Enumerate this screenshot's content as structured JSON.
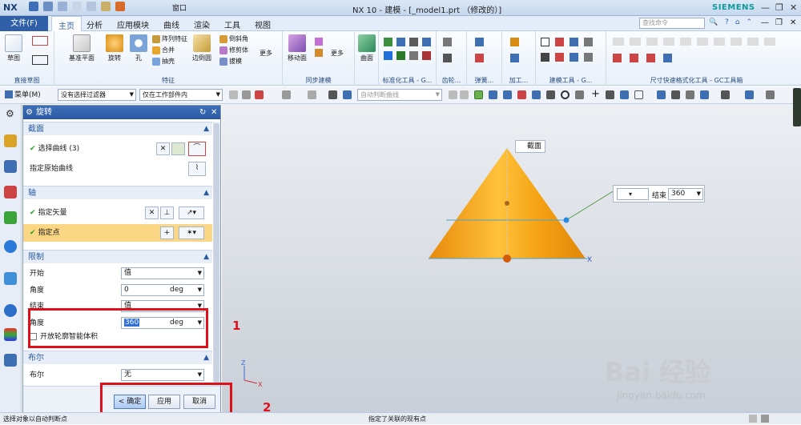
{
  "app": {
    "logo": "NX",
    "title": "NX 10 - 建模 - [_model1.prt （修改的）]",
    "brand": "SIEMENS",
    "window_menu": "窗口",
    "search_placeholder": "查找命令"
  },
  "tabs": {
    "file": "文件(F)",
    "items": [
      "主页",
      "分析",
      "应用模块",
      "曲线",
      "渲染",
      "工具",
      "视图"
    ],
    "active": "主页"
  },
  "ribbon": {
    "sketch": {
      "label": "草图",
      "group": "直接草图"
    },
    "feature": {
      "group": "特征",
      "datum": "基准平面",
      "revolve": "旋转",
      "hole": "孔",
      "pattern": "阵列特征",
      "unite": "合并",
      "shell": "抽壳",
      "edge_blend": "边倒圆",
      "chamfer": "倒斜角",
      "trim_body": "修剪体",
      "draft": "拔模",
      "more": "更多"
    },
    "sync": {
      "group": "同步建模",
      "move_face": "移动面",
      "more": "更多"
    },
    "surface": {
      "face": "曲面"
    },
    "groups_right": [
      "标准化工具 - G...",
      "齿轮...",
      "弹簧...",
      "加工...",
      "建模工具 - G...",
      "尺寸快速格式化工具 - GC工具箱"
    ]
  },
  "toolbar2": {
    "menu": "菜单(M)",
    "filter": "没有选择过滤器",
    "scope": "仅在工作部件内",
    "curve_rule": "自动判断曲线"
  },
  "dialog": {
    "title": "旋转",
    "section": {
      "header": "截面",
      "select_curve": "选择曲线 (3)",
      "origin_curve": "指定原始曲线"
    },
    "axis": {
      "header": "轴",
      "vector": "指定矢量",
      "point": "指定点"
    },
    "limits": {
      "header": "限制",
      "start_label": "开始",
      "start_type": "值",
      "angle1_label": "角度",
      "angle1_value": "0",
      "angle1_unit": "deg",
      "end_label": "结束",
      "end_type": "值",
      "angle2_label": "角度",
      "angle2_value": "360",
      "angle2_unit": "deg",
      "open_profile": "开放轮廓智能体积"
    },
    "boolean": {
      "header": "布尔",
      "label": "布尔",
      "value": "无"
    },
    "buttons": {
      "ok": "< 确定 >",
      "apply": "应用",
      "cancel": "取消"
    }
  },
  "viewport": {
    "section_label": "截面",
    "end_popup_label": "结束",
    "end_popup_value": "360",
    "x_axis": "X",
    "z_axis": "Z"
  },
  "annotations": {
    "num1": "1",
    "num2": "2"
  },
  "watermark": {
    "main": "Bai 经验",
    "sub": "jingyan.baidu.com"
  },
  "status": {
    "left": "选择对象以自动判断点",
    "middle": "指定了关联的现有点"
  },
  "colors": {
    "accent": "#2f5fa6",
    "highlight": "#fbd684",
    "cone": "#f5a214",
    "annotation_red": "#e0101b"
  }
}
